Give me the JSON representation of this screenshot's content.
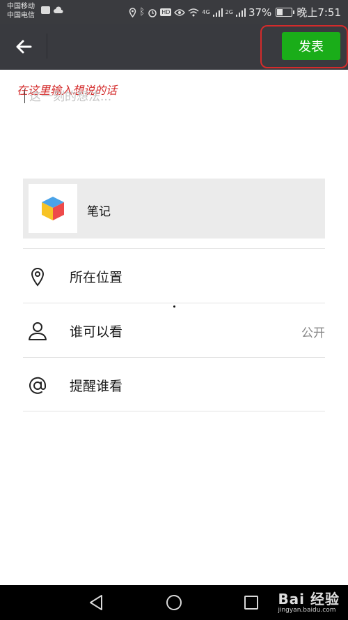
{
  "status_bar": {
    "carrier1": "中国移动",
    "carrier2": "中国电信",
    "net1": "4G",
    "net2": "2G",
    "battery": "37%",
    "battery_level": 0.37,
    "time": "晚上7:51"
  },
  "header": {
    "back_icon": "arrow-left-icon",
    "publish_label": "发表",
    "accent_color": "#1aad19",
    "highlight_color": "#d42b2b"
  },
  "compose": {
    "annotation": "在这里输入想说的话",
    "placeholder": "这一刻的想法..."
  },
  "attachment": {
    "title": "笔记",
    "icon": "colored-cube-icon"
  },
  "options": [
    {
      "label": "所在位置",
      "icon": "location-pin-icon",
      "value": ""
    },
    {
      "label": "谁可以看",
      "icon": "person-icon",
      "value": "公开"
    },
    {
      "label": "提醒谁看",
      "icon": "at-sign-icon",
      "value": ""
    }
  ],
  "nav": {
    "back": "triangle-back-icon",
    "home": "circle-home-icon",
    "recent": "square-recent-icon"
  },
  "watermark": {
    "main": "Bai 经验",
    "sub": "jingyan.baidu.com"
  }
}
